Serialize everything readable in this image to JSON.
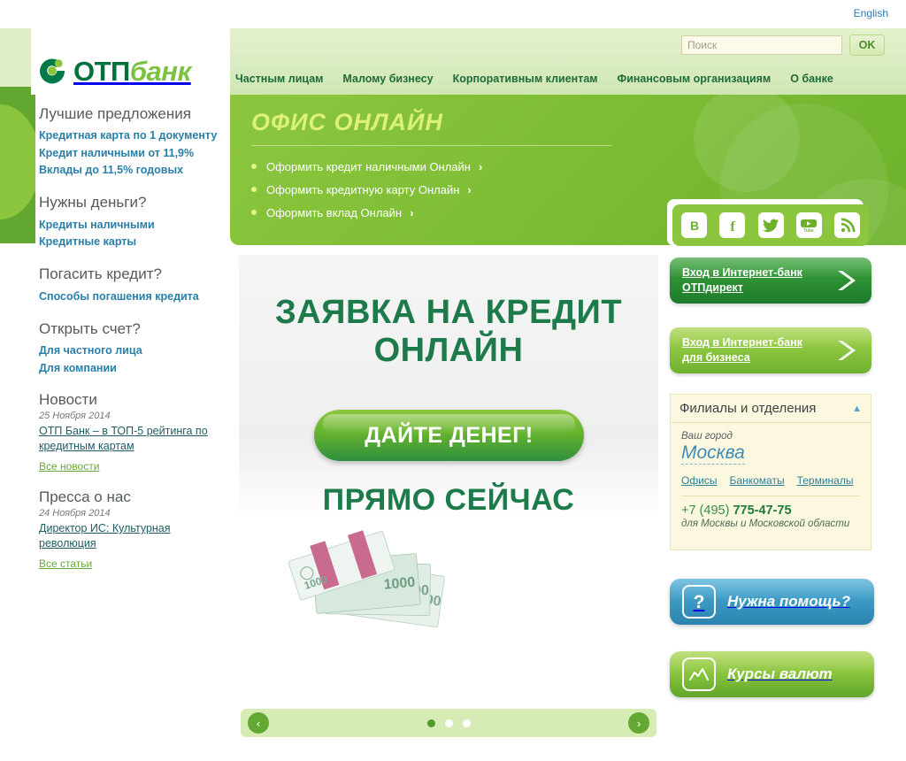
{
  "topbar": {
    "lang_link": "English"
  },
  "header": {
    "logo": {
      "otp": "ОТП",
      "bank": "банк",
      "mark": "otp-logo-mark"
    },
    "nav": [
      {
        "label": "Частным лицам",
        "name": "nav-private"
      },
      {
        "label": "Малому бизнесу",
        "name": "nav-small-business"
      },
      {
        "label": "Корпоративным клиентам",
        "name": "nav-corporate"
      },
      {
        "label": "Финансовым организациям",
        "name": "nav-financial"
      },
      {
        "label": "О банке",
        "name": "nav-about"
      }
    ],
    "search": {
      "placeholder": "Поиск",
      "value": "",
      "button": "OK"
    }
  },
  "sidebar": {
    "groups": [
      {
        "heading": "Лучшие предложения",
        "links": [
          "Кредитная карта по 1 документу",
          "Кредит наличными от 11,9%",
          "Вклады до 11,5% годовых"
        ]
      },
      {
        "heading": "Нужны деньги?",
        "links": [
          "Кредиты наличными",
          "Кредитные карты"
        ]
      },
      {
        "heading": "Погасить кредит?",
        "links": [
          "Способы погашения кредита"
        ]
      },
      {
        "heading": "Открыть счет?",
        "links": [
          "Для частного лица",
          "Для компании"
        ]
      }
    ],
    "news": {
      "heading": "Новости",
      "date": "25 Ноября 2014",
      "title": "ОТП Банк – в ТОП-5 рейтинга по кредитным картам",
      "all": "Все новости"
    },
    "press": {
      "heading": "Пресса о нас",
      "date": "24 Ноября 2014",
      "title": "Директор ИС: Культурная революция",
      "all": "Все статьи"
    }
  },
  "office": {
    "title": "ОФИС ОНЛАЙН",
    "items": [
      "Оформить кредит наличными Онлайн",
      "Оформить кредитную карту Онлайн",
      "Оформить вклад Онлайн"
    ],
    "arrow": "chevron-right-icon"
  },
  "banner": {
    "line1": "ЗАЯВКА НА КРЕДИТ",
    "line2": "ОНЛАЙН",
    "cta": "ДАЙТЕ ДЕНЕГ!",
    "line3": "ПРЯМО СЕЙЧАС",
    "image_alt": "rubles-banknotes"
  },
  "carousel": {
    "prev": "‹",
    "next": "›",
    "dots": 3,
    "active_dot": 1
  },
  "social": [
    {
      "name": "vk-icon",
      "glyph": "B"
    },
    {
      "name": "facebook-icon",
      "glyph": "f"
    },
    {
      "name": "twitter-icon",
      "glyph": "t"
    },
    {
      "name": "youtube-icon",
      "glyph": "You Tube"
    },
    {
      "name": "rss-icon",
      "glyph": "rss"
    }
  ],
  "internet_bank": [
    {
      "name": "ib-otpdirect",
      "line1": "Вход в Интернет-банк",
      "line2": "ОТПдирект"
    },
    {
      "name": "ib-business",
      "line1": "Вход в Интернет-банк",
      "line2": "для бизнеса"
    }
  ],
  "branches": {
    "title": "Филиалы и отделения",
    "caret": "▲",
    "city_label": "Ваш город",
    "city": "Москва",
    "links": [
      "Офисы",
      "Банкоматы",
      "Терминалы"
    ],
    "phone_code": "+7 (495)",
    "phone_number": "775-47-75",
    "phone_note": "для Москвы и Московской области"
  },
  "action_buttons": [
    {
      "name": "help-button",
      "label": "Нужна помощь?",
      "icon": "question-mark-icon"
    },
    {
      "name": "rates-button",
      "label": "Курсы валют",
      "icon": "chart-icon"
    }
  ],
  "colors": {
    "brand_green": "#8cc63f",
    "dark_green": "#00713c",
    "link_blue": "#2a7fa8",
    "cream": "#fbf8df",
    "help_blue": "#3c9cc6"
  }
}
